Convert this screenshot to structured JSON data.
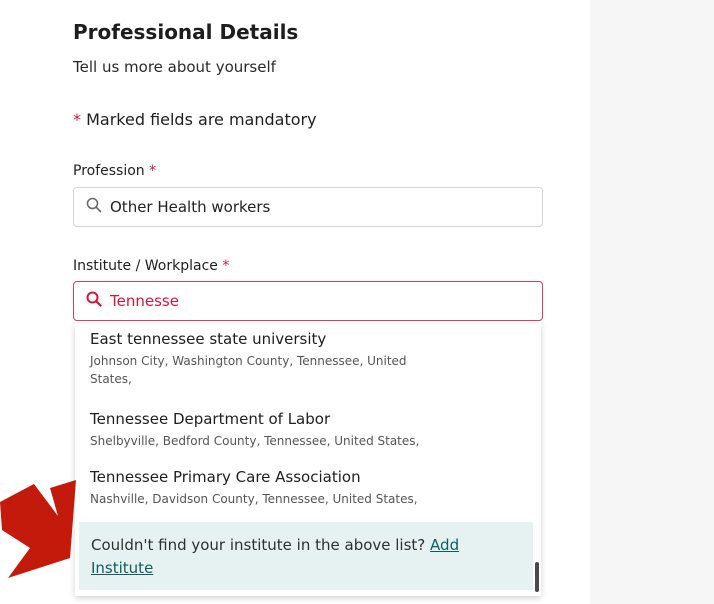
{
  "header": {
    "title": "Professional Details",
    "subtitle": "Tell us more about yourself"
  },
  "mandatory_note": {
    "asterisk": "*",
    "text": "Marked fields are mandatory"
  },
  "profession": {
    "label": "Profession",
    "required_mark": "*",
    "value": "Other Health workers",
    "icon": "search-icon"
  },
  "institute": {
    "label": "Institute / Workplace",
    "required_mark": "*",
    "value": "Tennesse",
    "icon": "search-icon"
  },
  "suggestions": [
    {
      "name": "East tennessee state university",
      "address_line1": "Johnson City,  Washington County,  Tennessee,  United",
      "address_line2": "States,"
    },
    {
      "name": "Tennessee Department of Labor",
      "address_line1": "Shelbyville,  Bedford County,  Tennessee,  United States,"
    },
    {
      "name": "Tennessee Primary Care Association",
      "address_line1": "Nashville,  Davidson County,  Tennessee,  United States,"
    }
  ],
  "add_institute": {
    "prompt": "Couldn't find your institute in the above list?",
    "link_part1": "Add",
    "link_part2": "Institute"
  },
  "colors": {
    "required": "#d9143c",
    "link": "#0e5d5d",
    "footer_bg": "#e6f2f2",
    "arrow": "#c41a0c"
  }
}
